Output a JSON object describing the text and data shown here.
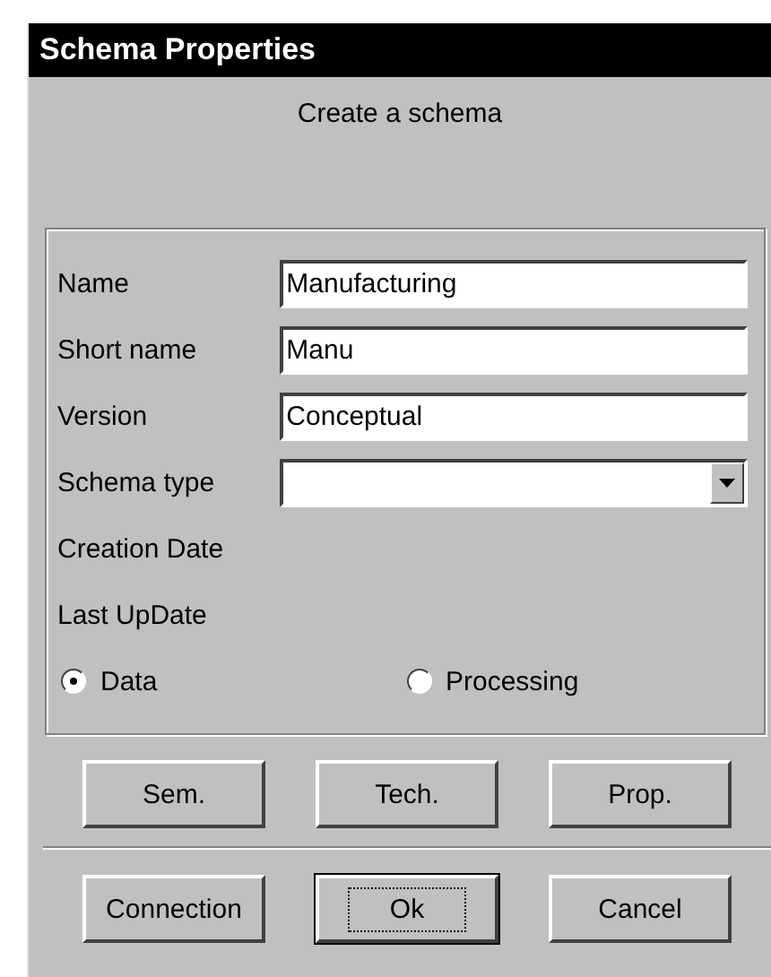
{
  "window": {
    "title": "Schema Properties"
  },
  "subtitle": "Create a schema",
  "fields": [
    {
      "kind": "text",
      "label": "Name",
      "value": "Manufacturing"
    },
    {
      "kind": "text",
      "label": "Short name",
      "value": "Manu"
    },
    {
      "kind": "text",
      "label": "Version",
      "value": "Conceptual"
    },
    {
      "kind": "dropdown",
      "label": "Schema type"
    },
    {
      "kind": "static",
      "label": "Creation Date"
    },
    {
      "kind": "static",
      "label": "Last UpDate"
    }
  ],
  "radios": [
    {
      "label": "Data",
      "selected": true
    },
    {
      "label": "Processing",
      "selected": false
    }
  ],
  "detail_buttons": [
    "Sem.",
    "Tech.",
    "Prop."
  ],
  "dialog_buttons": [
    {
      "label": "Connection",
      "default": false
    },
    {
      "label": "Ok",
      "default": true
    },
    {
      "label": "Cancel",
      "default": false
    }
  ]
}
